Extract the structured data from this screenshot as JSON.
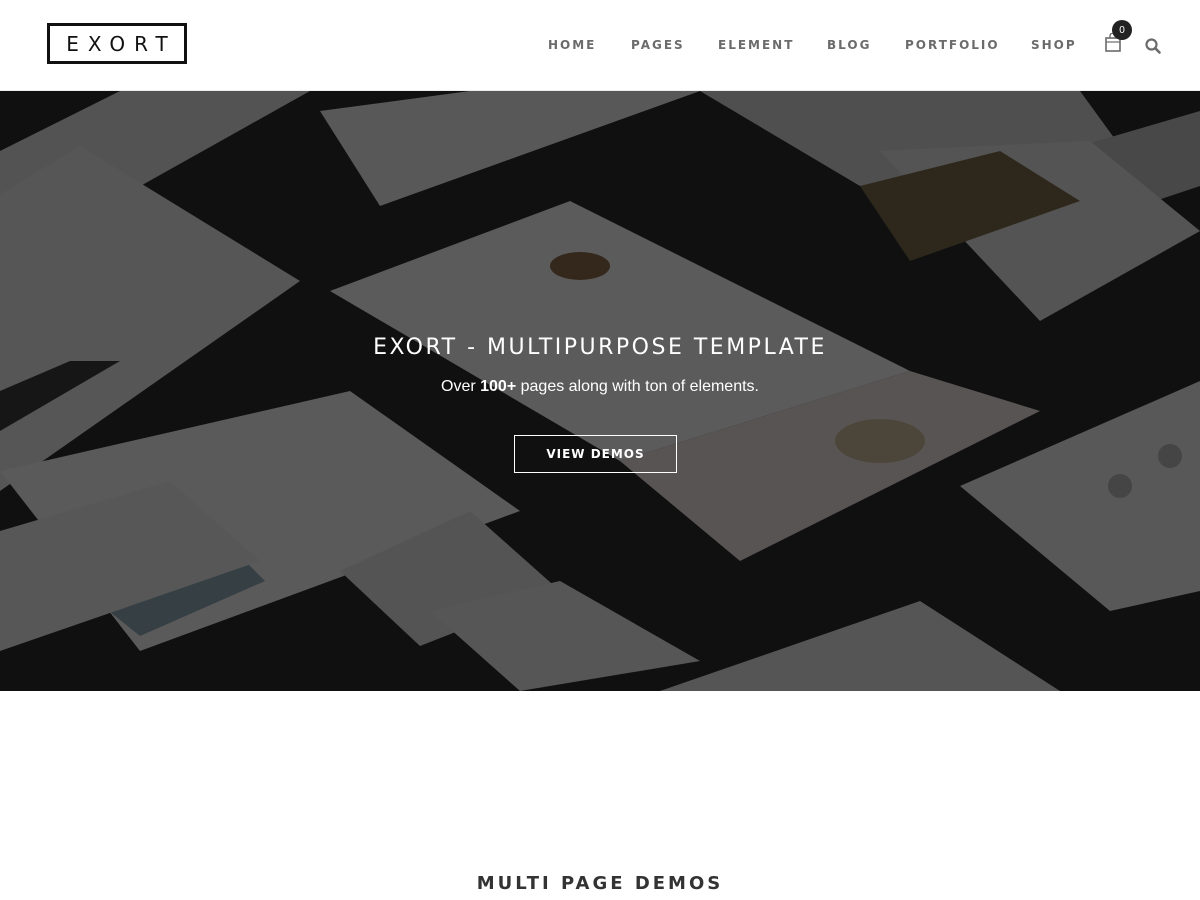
{
  "header": {
    "logo": "EXORT",
    "nav": [
      "HOME",
      "PAGES",
      "ELEMENT",
      "BLOG",
      "PORTFOLIO",
      "SHOP"
    ],
    "cart_count": "0",
    "icons": {
      "cart": "shopping-bag-icon",
      "search": "search-icon"
    }
  },
  "hero": {
    "title": "EXORT - MULTIPURPOSE TEMPLATE",
    "subtitle_prefix": "Over ",
    "subtitle_bold": "100+",
    "subtitle_suffix": " pages along with ton of elements.",
    "button_label": "VIEW DEMOS"
  },
  "section": {
    "title": "MULTI PAGE DEMOS"
  },
  "colors": {
    "text_dark": "#111111",
    "nav_text": "#6b6b6b",
    "hero_overlay": "#000000",
    "white": "#ffffff"
  }
}
